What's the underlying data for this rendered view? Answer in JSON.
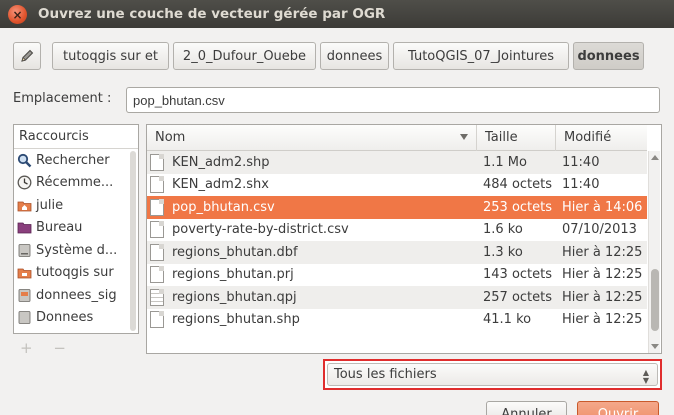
{
  "window": {
    "title": "Ouvrez une couche de vecteur gérée par OGR",
    "close_symbol": "×"
  },
  "pathbar": {
    "edit_icon": "pencil-icon",
    "crumbs": [
      "tutoqgis sur et",
      "2_0_Dufour_Ouebe",
      "donnees",
      "TutoQGIS_07_Jointures",
      "donnees"
    ],
    "active_index": 4
  },
  "location": {
    "label": "Emplacement :",
    "value": "pop_bhutan.csv"
  },
  "sidebar": {
    "header": "Raccourcis",
    "items": [
      {
        "label": "Rechercher",
        "icon": "search-icon"
      },
      {
        "label": "Récemme...",
        "icon": "recent-icon"
      },
      {
        "label": "julie",
        "icon": "home-folder-icon"
      },
      {
        "label": "Bureau",
        "icon": "desktop-icon"
      },
      {
        "label": "Système d...",
        "icon": "drive-icon"
      },
      {
        "label": "tutoqgis sur",
        "icon": "network-drive-icon"
      },
      {
        "label": "donnees_sig",
        "icon": "folder-icon"
      },
      {
        "label": "Donnees",
        "icon": "drive-icon"
      }
    ],
    "add_label": "+",
    "remove_label": "−"
  },
  "table": {
    "columns": {
      "name": "Nom",
      "size": "Taille",
      "modified": "Modifié"
    },
    "rows": [
      {
        "name": "KEN_adm2.shp",
        "size": "1.1 Mo",
        "modified": "11:40",
        "icon": "file-icon"
      },
      {
        "name": "KEN_adm2.shx",
        "size": "484 octets",
        "modified": "11:40",
        "icon": "file-icon"
      },
      {
        "name": "pop_bhutan.csv",
        "size": "253 octets",
        "modified": "Hier à 14:06",
        "icon": "file-icon"
      },
      {
        "name": "poverty-rate-by-district.csv",
        "size": "1.6 ko",
        "modified": "07/10/2013",
        "icon": "file-icon"
      },
      {
        "name": "regions_bhutan.dbf",
        "size": "1.3 ko",
        "modified": "Hier à 12:25",
        "icon": "file-icon"
      },
      {
        "name": "regions_bhutan.prj",
        "size": "143 octets",
        "modified": "Hier à 12:25",
        "icon": "file-icon"
      },
      {
        "name": "regions_bhutan.qpj",
        "size": "257 octets",
        "modified": "Hier à 12:25",
        "icon": "text-file-icon"
      },
      {
        "name": "regions_bhutan.shp",
        "size": "41.1 ko",
        "modified": "Hier à 12:25",
        "icon": "file-icon"
      }
    ],
    "selected_index": 2
  },
  "filter": {
    "value": "Tous les fichiers"
  },
  "buttons": {
    "cancel": "Annuler",
    "open": "Ouvrir"
  },
  "colors": {
    "accent": "#f07746",
    "highlight_border": "#e02d2d"
  }
}
